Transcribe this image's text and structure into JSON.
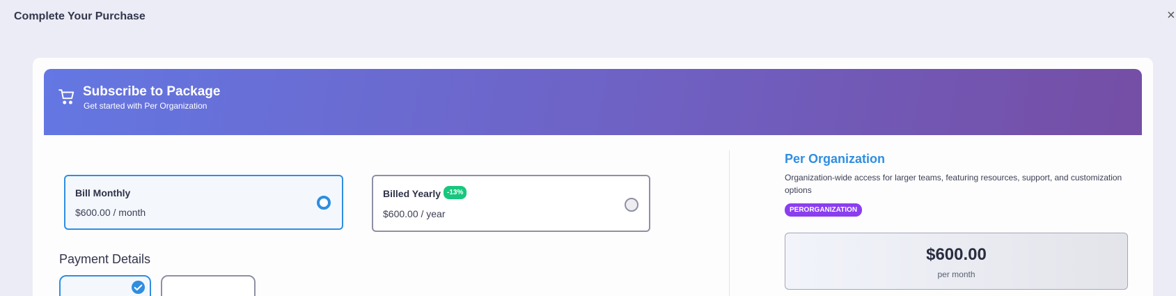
{
  "modal": {
    "title": "Complete Your Purchase",
    "close_label": "×"
  },
  "banner": {
    "icon": "shopping-cart-icon",
    "title": "Subscribe to Package",
    "subtitle": "Get started with Per Organization"
  },
  "billing": {
    "options": [
      {
        "label": "Bill Monthly",
        "price": "$600.00 / month",
        "selected": true
      },
      {
        "label": "Billed Yearly",
        "price": "$600.00 / year",
        "badge": "-13%",
        "selected": false
      }
    ]
  },
  "payment": {
    "title": "Payment Details",
    "methods": [
      {
        "selected": true,
        "icon": "check-circle-icon"
      },
      {
        "selected": false
      }
    ]
  },
  "package": {
    "name": "Per Organization",
    "description": "Organization-wide access for larger teams, featuring resources, support, and customization options",
    "tag": "PERORGANIZATION",
    "price": "$600.00",
    "period": "per month"
  },
  "colors": {
    "accent": "#2f8ee0",
    "banner_start": "#6477e2",
    "banner_end": "#754ea5",
    "badge_green": "#18c77e",
    "tag_purple": "#8b3ef0",
    "background": "#ececf6"
  }
}
